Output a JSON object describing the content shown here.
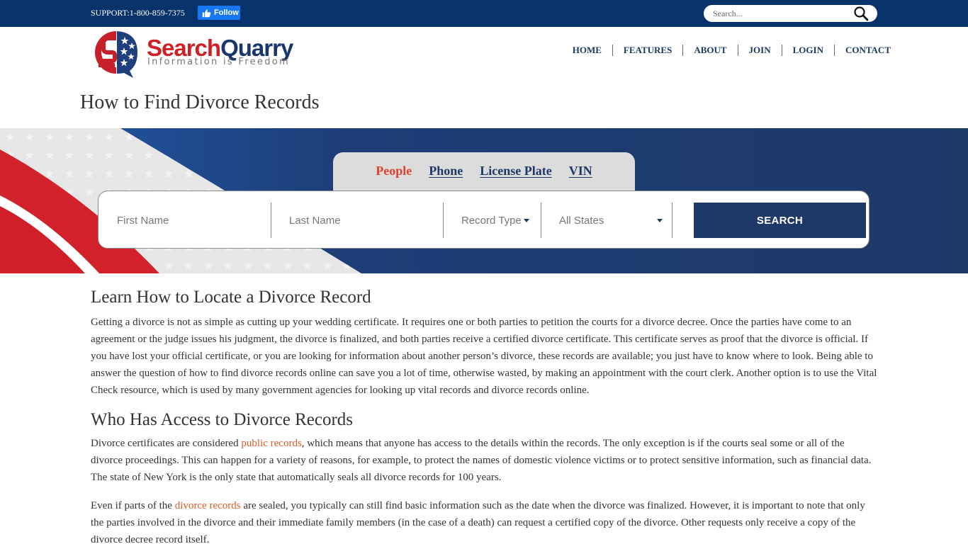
{
  "topbar": {
    "support_text": "SUPPORT:1-800-859-7375",
    "follow_label": "Follow",
    "search_placeholder": "Search..."
  },
  "logo": {
    "word1": "Search",
    "word2": "Quarry",
    "tagline": "Information is Freedom"
  },
  "nav": {
    "items": [
      "HOME",
      "FEATURES",
      "ABOUT",
      "JOIN",
      "LOGIN",
      "CONTACT"
    ]
  },
  "page_title": "How to Find Divorce Records",
  "search": {
    "tabs": [
      {
        "label": "People",
        "active": true
      },
      {
        "label": "Phone",
        "active": false
      },
      {
        "label": "License Plate",
        "active": false
      },
      {
        "label": "VIN",
        "active": false
      }
    ],
    "first_name_placeholder": "First Name",
    "last_name_placeholder": "Last Name",
    "record_type_label": "Record Type",
    "state_label": "All States",
    "button_label": "SEARCH"
  },
  "colors": {
    "topbar": "#07336a",
    "navy": "#1e3868",
    "accent_red": "#e0412e",
    "link_orange": "#e05a25"
  },
  "content": {
    "section1": {
      "heading": "Learn How to Locate a Divorce Record",
      "paragraph": "Getting a divorce is not as simple as cutting up your wedding certificate. It requires one or both parties to petition the courts for a divorce decree. Once the parties have come to an agreement or the judge issues his judgment, the divorce is finalized, and both parties receive a certified divorce certificate. This certificate serves as proof that the divorce is official. If you have lost your official certificate, or you are looking for information about another person’s divorce, these records are available; you just have to know where to look. Being able to answer the question of how to find divorce records online can save you a lot of time, otherwise wasted, by making an appointment with the court clerk. Another option is to use the Vital Check resource, which is used by many government agencies for looking up vital records and divorce records online."
    },
    "section2": {
      "heading": "Who Has Access to Divorce Records",
      "p1_before": "Divorce certificates are considered ",
      "p1_link": "public records",
      "p1_after": ", which means that anyone has access to the details within the records. The only exception is if the courts seal some or all of the divorce proceedings. This can happen for a variety of reasons, for example, to protect the names of domestic violence victims or to protect sensitive information, such as financial data. The state of New York is the only state that automatically seals all divorce records for 100 years.",
      "p2_before": "Even if parts of the ",
      "p2_link": "divorce records",
      "p2_after": " are sealed, you typically can still find basic information such as the date when the divorce was finalized. However, it is important to note that only the parties involved in the divorce and their immediate family members (in the case of a death) can request a certified copy of the divorce. Other requests only receive a copy of the divorce decree record itself."
    }
  }
}
